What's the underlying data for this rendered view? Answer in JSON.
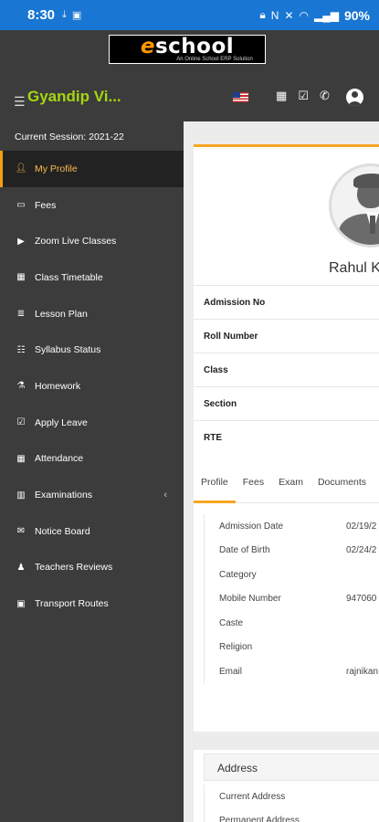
{
  "status_bar": {
    "time": "8:30",
    "battery": "90%"
  },
  "header": {
    "logo_main": "school",
    "logo_tagline": "An Online School ERP Solution",
    "brand": "Gyandip Vi..."
  },
  "sidebar": {
    "session": "Current Session: 2021-22",
    "items": [
      {
        "label": "My Profile",
        "icon": "user-icon"
      },
      {
        "label": "Fees",
        "icon": "money-icon"
      },
      {
        "label": "Zoom Live Classes",
        "icon": "video-icon"
      },
      {
        "label": "Class Timetable",
        "icon": "calendar-icon"
      },
      {
        "label": "Lesson Plan",
        "icon": "list-icon"
      },
      {
        "label": "Syllabus Status",
        "icon": "list-icon"
      },
      {
        "label": "Homework",
        "icon": "flask-icon"
      },
      {
        "label": "Apply Leave",
        "icon": "check-icon"
      },
      {
        "label": "Attendance",
        "icon": "calendar-check-icon"
      },
      {
        "label": "Examinations",
        "icon": "map-icon"
      },
      {
        "label": "Notice Board",
        "icon": "envelope-icon"
      },
      {
        "label": "Teachers Reviews",
        "icon": "user-tie-icon"
      },
      {
        "label": "Transport Routes",
        "icon": "bus-icon"
      }
    ]
  },
  "profile": {
    "name": "Rahul K",
    "fields": [
      "Admission No",
      "Roll Number",
      "Class",
      "Section",
      "RTE"
    ]
  },
  "tabs": [
    "Profile",
    "Fees",
    "Exam",
    "Documents"
  ],
  "details": [
    {
      "label": "Admission Date",
      "value": "02/19/2"
    },
    {
      "label": "Date of Birth",
      "value": "02/24/2"
    },
    {
      "label": "Category",
      "value": ""
    },
    {
      "label": "Mobile Number",
      "value": "947060"
    },
    {
      "label": "Caste",
      "value": ""
    },
    {
      "label": "Religion",
      "value": ""
    },
    {
      "label": "Email",
      "value": "rajnikan"
    }
  ],
  "address": {
    "title": "Address",
    "rows": [
      "Current Address",
      "Permanent Address"
    ]
  }
}
